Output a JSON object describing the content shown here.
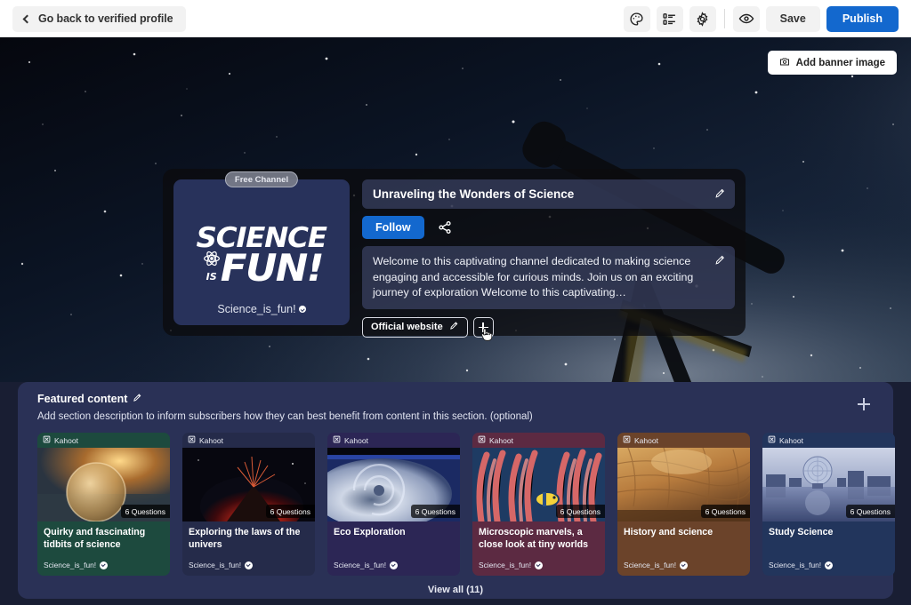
{
  "topbar": {
    "back_label": "Go back to verified profile",
    "back_icon": "chevron-left-icon",
    "icons": [
      {
        "name": "theme-palette-icon",
        "label": "Theme"
      },
      {
        "name": "sections-list-icon",
        "label": "Sections"
      },
      {
        "name": "gear-icon",
        "label": "Settings"
      },
      {
        "name": "eye-preview-icon",
        "label": "Preview"
      }
    ],
    "save_label": "Save",
    "publish_label": "Publish",
    "publish_color": "#1368ce"
  },
  "banner": {
    "add_banner_label": "Add banner image",
    "add_banner_icon": "camera-icon",
    "alt": "starry night sky with telescope silhouette"
  },
  "channel": {
    "free_badge": "Free Channel",
    "logo_line1": "SCIENCE",
    "logo_line2_small": "IS",
    "logo_line3": "FUN!",
    "logo_atom_icon": "atom-icon",
    "handle": "Science_is_fun!",
    "handle_verified_icon": "verified-badge-icon",
    "title": "Unraveling the Wonders of Science",
    "title_edit_icon": "pencil-icon",
    "follow_label": "Follow",
    "share_icon": "share-icon",
    "description": "Welcome to this captivating channel dedicated to making science engaging and accessible for curious minds. Join us on an exciting journey of exploration Welcome to this captivating…",
    "description_edit_icon": "pencil-icon",
    "website_label": "Official website",
    "website_edit_icon": "pencil-icon",
    "add_link_icon": "plus-icon",
    "cursor_icon": "pointer-hand-cursor"
  },
  "featured": {
    "section_title": "Featured content",
    "section_title_edit_icon": "pencil-icon",
    "section_description_placeholder": "Add section description to inform subscribers how they can best benefit from content in this section. (optional)",
    "add_icon": "plus-icon",
    "view_all_label": "View all (11)",
    "cards": [
      {
        "kind": "Kahoot",
        "kind_icon": "kahoot-grid-icon",
        "questions": "6 Questions",
        "title": "Quirky and fascinating tidbits of science",
        "author": "Science_is_fun!",
        "verified_icon": "verified-badge-icon",
        "color": "#1d4a3e",
        "image": "frozen-soap-bubble-at-sunset"
      },
      {
        "kind": "Kahoot",
        "kind_icon": "kahoot-grid-icon",
        "questions": "6 Questions",
        "title": "Exploring the laws of the univers",
        "author": "Science_is_fun!",
        "verified_icon": "verified-badge-icon",
        "color": "#252b4a",
        "image": "erupting-volcano-at-night"
      },
      {
        "kind": "Kahoot",
        "kind_icon": "kahoot-grid-icon",
        "questions": "6 Questions",
        "title": "Eco Exploration",
        "author": "Science_is_fun!",
        "verified_icon": "verified-badge-icon",
        "color": "#2c2655",
        "image": "hurricane-from-space"
      },
      {
        "kind": "Kahoot",
        "kind_icon": "kahoot-grid-icon",
        "questions": "6 Questions",
        "title": "Microscopic marvels, a close look at tiny worlds",
        "author": "Science_is_fun!",
        "verified_icon": "verified-badge-icon",
        "color": "#5c2a42",
        "image": "coral-reef-with-clownfish"
      },
      {
        "kind": "Kahoot",
        "kind_icon": "kahoot-grid-icon",
        "questions": "6 Questions",
        "title": "History and science",
        "author": "Science_is_fun!",
        "verified_icon": "verified-badge-icon",
        "color": "#6b432a",
        "image": "sandstone-canyon-cliff"
      },
      {
        "kind": "Kahoot",
        "kind_icon": "kahoot-grid-icon",
        "questions": "6 Questions",
        "title": "Study Science",
        "author": "Science_is_fun!",
        "verified_icon": "verified-badge-icon",
        "color": "#22355c",
        "image": "science-world-dome-reflection"
      }
    ]
  }
}
